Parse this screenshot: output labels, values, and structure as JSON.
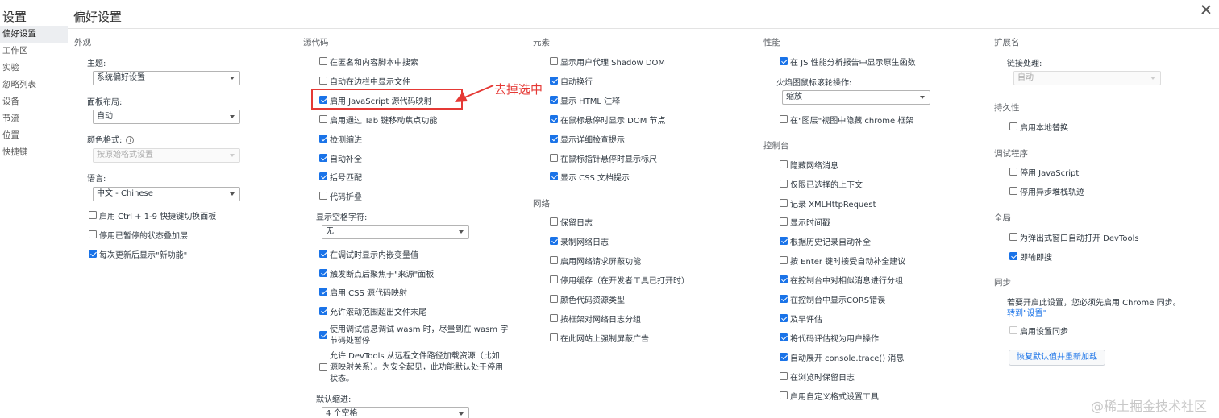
{
  "sidebar": {
    "title": "设置",
    "items": [
      "偏好设置",
      "工作区",
      "实验",
      "忽略列表",
      "设备",
      "节流",
      "位置",
      "快捷键"
    ]
  },
  "page_title": "偏好设置",
  "appearance": {
    "title": "外观",
    "theme_label": "主题:",
    "theme_value": "系统偏好设置",
    "panel_layout_label": "面板布局:",
    "panel_layout_value": "自动",
    "color_format_label": "颜色格式:",
    "color_format_value": "按原始格式设置",
    "language_label": "语言:",
    "language_value": "中文 - Chinese",
    "checks": [
      {
        "label": "启用 Ctrl + 1-9 快捷键切换面板",
        "checked": false
      },
      {
        "label": "停用已暂停的状态叠加层",
        "checked": false
      },
      {
        "label": "每次更新后显示\"新功能\"",
        "checked": true
      }
    ]
  },
  "sources": {
    "title": "源代码",
    "checks": [
      {
        "label": "在匿名和内容脚本中搜索",
        "checked": false
      },
      {
        "label": "自动在边栏中显示文件",
        "checked": false
      },
      {
        "label": "启用 JavaScript 源代码映射",
        "checked": true
      },
      {
        "label": "启用通过 Tab 键移动焦点功能",
        "checked": false
      },
      {
        "label": "检测缩进",
        "checked": true
      },
      {
        "label": "自动补全",
        "checked": true
      },
      {
        "label": "括号匹配",
        "checked": true
      },
      {
        "label": "代码折叠",
        "checked": false
      }
    ],
    "whitespace_label": "显示空格字符:",
    "whitespace_value": "无",
    "checks2": [
      {
        "label": "在调试时显示内嵌变量值",
        "checked": true
      },
      {
        "label": "触发断点后聚焦于\"来源\"面板",
        "checked": true
      },
      {
        "label": "启用 CSS 源代码映射",
        "checked": true
      },
      {
        "label": "允许滚动范围超出文件末尾",
        "checked": true
      },
      {
        "label": "使用调试信息调试 wasm 时，尽量到在 wasm 字节码处暂停",
        "checked": true
      },
      {
        "label": "允许 DevTools 从远程文件路径加载资源（比如源映射关系）。为安全起见，此功能默认处于停用状态。",
        "checked": false
      }
    ],
    "indent_label": "默认缩进:",
    "indent_value": "4 个空格"
  },
  "elements": {
    "title": "元素",
    "checks": [
      {
        "label": "显示用户代理 Shadow DOM",
        "checked": false
      },
      {
        "label": "自动换行",
        "checked": true
      },
      {
        "label": "显示 HTML 注释",
        "checked": true
      },
      {
        "label": "在鼠标悬停时显示 DOM 节点",
        "checked": true
      },
      {
        "label": "显示详细检查提示",
        "checked": true
      },
      {
        "label": "在鼠标指针悬停时显示标尺",
        "checked": false
      },
      {
        "label": "显示 CSS 文档提示",
        "checked": true
      }
    ]
  },
  "network": {
    "title": "网络",
    "checks": [
      {
        "label": "保留日志",
        "checked": false
      },
      {
        "label": "录制网络日志",
        "checked": true
      },
      {
        "label": "启用网络请求屏蔽功能",
        "checked": false
      },
      {
        "label": "停用缓存（在开发者工具已打开时）",
        "checked": false
      },
      {
        "label": "颜色代码资源类型",
        "checked": false
      },
      {
        "label": "按框架对网络日志分组",
        "checked": false
      },
      {
        "label": "在此网站上强制屏蔽广告",
        "checked": false
      }
    ]
  },
  "performance": {
    "title": "性能",
    "check1": {
      "label": "在 JS 性能分析报告中显示原生函数",
      "checked": true
    },
    "flame_label": "火焰图鼠标滚轮操作:",
    "flame_value": "缩放",
    "check2": {
      "label": "在\"图层\"视图中隐藏 chrome 框架",
      "checked": false
    }
  },
  "console": {
    "title": "控制台",
    "checks": [
      {
        "label": "隐藏网络消息",
        "checked": false
      },
      {
        "label": "仅限已选择的上下文",
        "checked": false
      },
      {
        "label": "记录 XMLHttpRequest",
        "checked": false
      },
      {
        "label": "显示时间戳",
        "checked": false
      },
      {
        "label": "根据历史记录自动补全",
        "checked": true
      },
      {
        "label": "按 Enter 键时接受自动补全建议",
        "checked": false
      },
      {
        "label": "在控制台中对相似消息进行分组",
        "checked": true
      },
      {
        "label": "在控制台中显示CORS错误",
        "checked": true
      },
      {
        "label": "及早评估",
        "checked": true
      },
      {
        "label": "将代码评估视为用户操作",
        "checked": true
      },
      {
        "label": "自动展开 console.trace() 消息",
        "checked": true
      },
      {
        "label": "在浏览时保留日志",
        "checked": false
      },
      {
        "label": "启用自定义格式设置工具",
        "checked": false
      }
    ]
  },
  "extensions": {
    "title": "扩展名",
    "link_label": "链接处理:",
    "link_value": "自动"
  },
  "persistence": {
    "title": "持久性",
    "check": {
      "label": "启用本地替换",
      "checked": false
    }
  },
  "debugger": {
    "title": "调试程序",
    "checks": [
      {
        "label": "停用 JavaScript",
        "checked": false
      },
      {
        "label": "停用异步堆栈轨迹",
        "checked": false
      }
    ]
  },
  "global": {
    "title": "全局",
    "checks": [
      {
        "label": "为弹出式窗口自动打开 DevTools",
        "checked": false
      },
      {
        "label": "即输即搜",
        "checked": true
      }
    ]
  },
  "sync": {
    "title": "同步",
    "desc": "若要开启此设置，您必须先启用 Chrome 同步。",
    "link": "转到\"设置\"",
    "check": {
      "label": "启用设置同步",
      "checked": false
    },
    "reset_button": "恢复默认值并重新加载"
  },
  "annotation": "去掉选中",
  "watermark": "@稀土掘金技术社区",
  "colors": {
    "accent": "#1a73e8",
    "annotation": "#e53935"
  }
}
